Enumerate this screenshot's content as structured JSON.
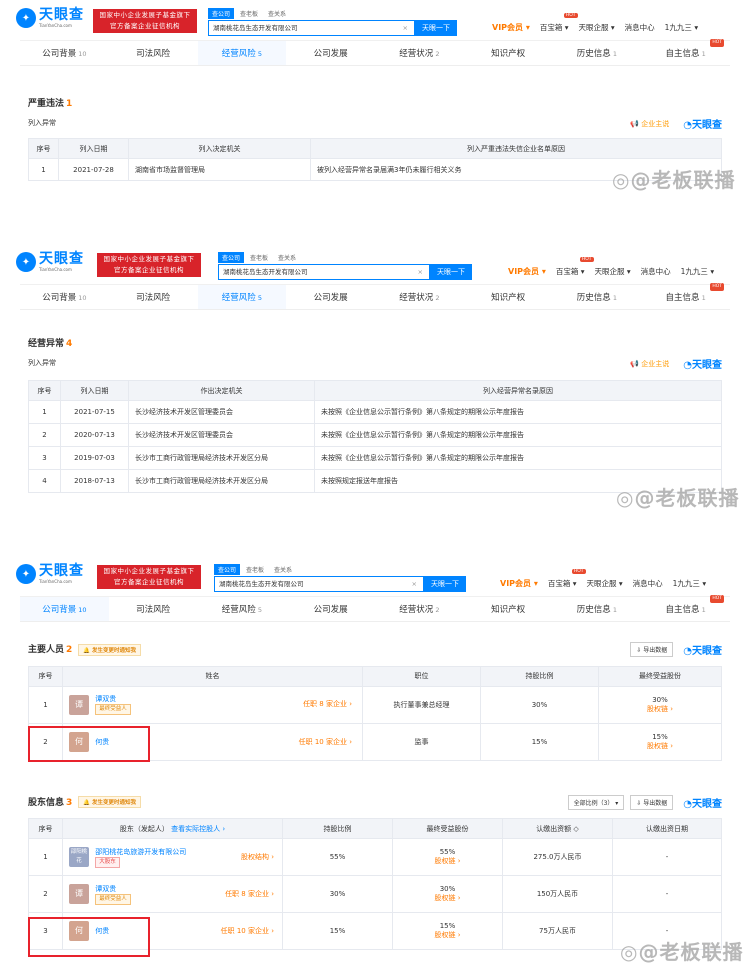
{
  "header": {
    "logo_text": "天眼查",
    "logo_sub": "TianYanCha.com",
    "cert_line1": "国家中小企业发展子基金旗下",
    "cert_line2": "官方备案企业征信机构",
    "search_tabs": [
      "查公司",
      "查老板",
      "查关系"
    ],
    "search_value": "湖南桃花岛生态开发有限公司",
    "search_button": "天眼一下",
    "vip": "VIP会员",
    "treasure": "百宝箱",
    "hot": "HOT",
    "enterprise": "天眼企服",
    "messages": "消息中心",
    "user": "1九九三"
  },
  "tabs": [
    {
      "label": "公司背景",
      "count": "10"
    },
    {
      "label": "司法风险",
      "count": ""
    },
    {
      "label": "经营风险",
      "count": "5"
    },
    {
      "label": "公司发展",
      "count": ""
    },
    {
      "label": "经营状况",
      "count": "2"
    },
    {
      "label": "知识产权",
      "count": ""
    },
    {
      "label": "历史信息",
      "count": "1"
    },
    {
      "label": "自主信息",
      "count": "1"
    }
  ],
  "brand_mini": "企业主说",
  "brand_tyc": "天眼查",
  "watermark": "@老板联播",
  "panel1": {
    "title": "严重违法",
    "count": "1",
    "sub": "列入异常",
    "columns": [
      "序号",
      "列入日期",
      "列入决定机关",
      "列入严重违法失信企业名单原因"
    ],
    "rows": [
      [
        "1",
        "2021-07-28",
        "湖南省市场监督管理局",
        "被列入经营异常名录届满3年仍未履行相关义务"
      ]
    ]
  },
  "panel2": {
    "title": "经营异常",
    "count": "4",
    "sub": "列入异常",
    "columns": [
      "序号",
      "列入日期",
      "作出决定机关",
      "列入经营异常名录原因"
    ],
    "rows": [
      [
        "1",
        "2021-07-15",
        "长沙经济技术开发区管理委员会",
        "未按照《企业信息公示暂行条例》第八条规定的期限公示年度报告"
      ],
      [
        "2",
        "2020-07-13",
        "长沙经济技术开发区管理委员会",
        "未按照《企业信息公示暂行条例》第八条规定的期限公示年度报告"
      ],
      [
        "3",
        "2019-07-03",
        "长沙市工商行政管理局经济技术开发区分局",
        "未按照《企业信息公示暂行条例》第八条规定的期限公示年度报告"
      ],
      [
        "4",
        "2018-07-13",
        "长沙市工商行政管理局经济技术开发区分局",
        "未按照规定报送年度报告"
      ]
    ]
  },
  "panel3": {
    "staff_title": "主要人员",
    "staff_count": "2",
    "notice": "发生变更时通知我",
    "export": "导出数据",
    "staff_columns": [
      "序号",
      "姓名",
      "职位",
      "持股比例",
      "最终受益股份"
    ],
    "staff_rows": [
      {
        "no": "1",
        "avatar": "谭",
        "name": "谭双贵",
        "tag": "最终受益人",
        "jobs": "任职 8 家企业 ›",
        "position": "执行董事兼总经理",
        "ratio": "30%",
        "benefit": "30%",
        "chain": "股权链 ›"
      },
      {
        "no": "2",
        "avatar": "何",
        "name": "何贵",
        "tag": "",
        "jobs": "任职 10 家企业 ›",
        "position": "监事",
        "ratio": "15%",
        "benefit": "15%",
        "chain": "股权链 ›"
      }
    ],
    "holder_title": "股东信息",
    "holder_count": "3",
    "ratio_select": "全部比例（3）",
    "holder_columns": [
      "序号",
      "股东（发起人）",
      "查看实际控股人 ›",
      "持股比例",
      "最终受益股份",
      "认缴出资额 ◇",
      "认缴出资日期"
    ],
    "holder_rows": [
      {
        "no": "1",
        "avatar": "邵阳桃花",
        "name": "邵阳桃花岛旅游开发有限公司",
        "tag": "大股东",
        "tagred": true,
        "link": "股权结构 ›",
        "ratio": "55%",
        "benefit": "55%",
        "chain": "股权链 ›",
        "capital": "275.0万人民币",
        "date": "-"
      },
      {
        "no": "2",
        "avatar": "谭",
        "name": "谭双贵",
        "tag": "最终受益人",
        "tagred": false,
        "link": "任职 8 家企业 ›",
        "ratio": "30%",
        "benefit": "30%",
        "chain": "股权链 ›",
        "capital": "150万人民币",
        "date": "-"
      },
      {
        "no": "3",
        "avatar": "何",
        "name": "何贵",
        "tag": "",
        "tagred": false,
        "link": "任职 10 家企业 ›",
        "ratio": "15%",
        "benefit": "15%",
        "chain": "股权链 ›",
        "capital": "75万人民币",
        "date": "-"
      }
    ]
  }
}
